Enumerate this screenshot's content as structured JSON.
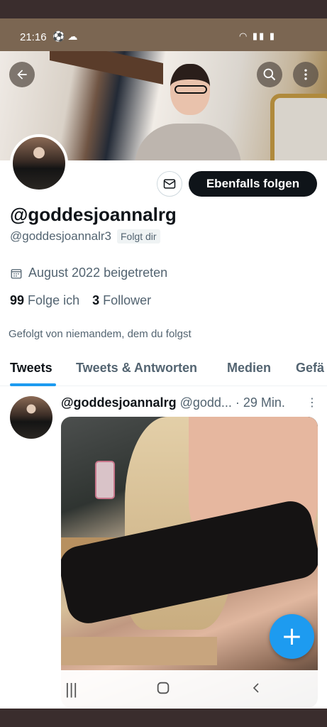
{
  "status_bar": {
    "time": "21:16"
  },
  "profile": {
    "display_name": "@goddesjoannalrg",
    "handle": "@goddesjoannalr3",
    "follows_you_badge": "Folgt dir",
    "joined": "August 2022 beigetreten",
    "following_count": "99",
    "following_label": "Folge ich",
    "followers_count": "3",
    "followers_label": "Follower",
    "followed_by": "Gefolgt von niemandem, dem du folgst"
  },
  "actions": {
    "follow_back_label": "Ebenfalls folgen"
  },
  "tabs": [
    {
      "label": "Tweets",
      "active": true
    },
    {
      "label": "Tweets & Antworten",
      "active": false
    },
    {
      "label": "Medien",
      "active": false
    },
    {
      "label": "Gefä",
      "active": false
    }
  ],
  "tweet": {
    "name": "@goddesjoannalrg",
    "handle": "@godd...",
    "time": "· 29 Min."
  },
  "icons": {
    "back": "arrow-left-icon",
    "search": "search-icon",
    "more": "more-vertical-icon",
    "message": "mail-icon",
    "calendar": "calendar-icon",
    "compose": "plus-icon"
  },
  "colors": {
    "accent": "#1d9bf0",
    "text": "#0f1419",
    "secondary": "#536471"
  }
}
